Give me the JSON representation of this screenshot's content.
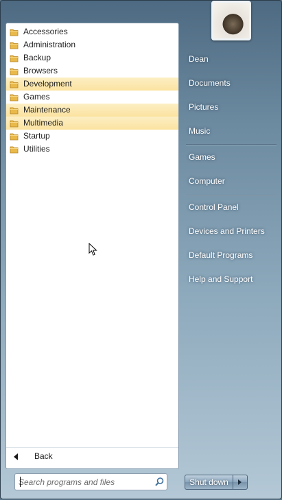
{
  "programs": [
    {
      "label": "Accessories",
      "highlighted": false,
      "icon": "folder-icon"
    },
    {
      "label": "Administration",
      "highlighted": false,
      "icon": "folder-icon"
    },
    {
      "label": "Backup",
      "highlighted": false,
      "icon": "folder-icon"
    },
    {
      "label": "Browsers",
      "highlighted": false,
      "icon": "folder-icon"
    },
    {
      "label": "Development",
      "highlighted": true,
      "icon": "folder-icon"
    },
    {
      "label": "Games",
      "highlighted": false,
      "icon": "folder-icon"
    },
    {
      "label": "Maintenance",
      "highlighted": true,
      "icon": "folder-icon"
    },
    {
      "label": "Multimedia",
      "highlighted": true,
      "icon": "folder-icon"
    },
    {
      "label": "Startup",
      "highlighted": false,
      "icon": "folder-icon"
    },
    {
      "label": "Utilities",
      "highlighted": false,
      "icon": "folder-icon"
    }
  ],
  "back": {
    "label": "Back",
    "icon": "back-arrow-icon"
  },
  "search": {
    "placeholder": "Search programs and files",
    "icon": "search-icon"
  },
  "right_pane": {
    "user": "Dean",
    "items": [
      "Documents",
      "Pictures",
      "Music",
      "Games",
      "Computer",
      "Control Panel",
      "Devices and Printers",
      "Default Programs",
      "Help and Support"
    ]
  },
  "shutdown": {
    "label": "Shut down",
    "icon": "chevron-right-icon"
  },
  "colors": {
    "highlight": "#fbe29f",
    "pane_bg": "#ffffff",
    "frame": "#6c8aa0"
  }
}
